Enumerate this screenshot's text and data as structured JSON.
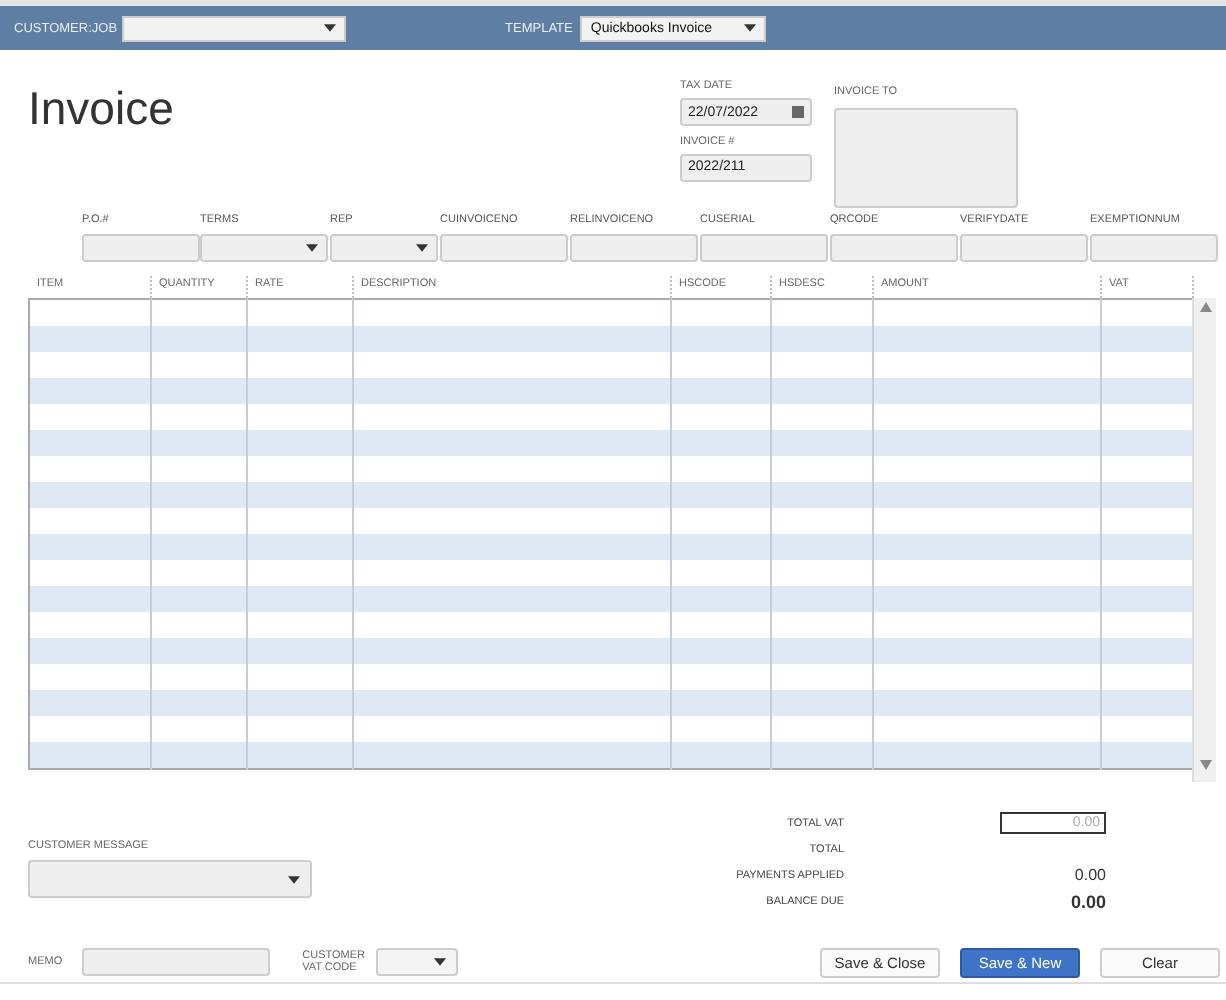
{
  "header": {
    "customer_job": {
      "label": "CUSTOMER:JOB"
    },
    "template": {
      "label": "TEMPLATE",
      "value": "Quickbooks Invoice"
    }
  },
  "title": "Invoice",
  "tax_date": {
    "label": "TAX DATE",
    "value": "22/07/2022"
  },
  "invoice_number": {
    "label": "INVOICE #",
    "value": "2022/211"
  },
  "invoice_to": {
    "label": "INVOICE TO"
  },
  "fields": [
    {
      "label": "P.O.#",
      "kind": "text"
    },
    {
      "label": "TERMS",
      "kind": "dropdown"
    },
    {
      "label": "REP",
      "kind": "dropdown"
    },
    {
      "label": "CUINVOICENO",
      "kind": "text"
    },
    {
      "label": "RELINVOICENO",
      "kind": "text"
    },
    {
      "label": "CUSERIAL",
      "kind": "text"
    },
    {
      "label": "QRCODE",
      "kind": "text"
    },
    {
      "label": "VERIFYDATE",
      "kind": "text"
    },
    {
      "label": "EXEMPTIONNUM",
      "kind": "text"
    }
  ],
  "table": {
    "columns": [
      "ITEM",
      "QUANTITY",
      "RATE",
      "DESCRIPTION",
      "HSCODE",
      "HSDESC",
      "AMOUNT",
      "VAT"
    ]
  },
  "totals": [
    {
      "label": "TOTAL VAT",
      "placeholder": "0.00",
      "kind": "field"
    },
    {
      "label": "TOTAL",
      "kind": "label"
    },
    {
      "label": "PAYMENTS APPLIED",
      "value": "0.00",
      "kind": "plain"
    },
    {
      "label": "BALANCE DUE",
      "value": "0.00",
      "kind": "bold"
    }
  ],
  "customer_message": {
    "label": "CUSTOMER MESSAGE"
  },
  "memo": {
    "label": "MEMO"
  },
  "customer_vat_code": {
    "label": "CUSTOMER VAT CODE"
  },
  "buttons": [
    {
      "label": "Save & Close",
      "kind": "secondary"
    },
    {
      "label": "Save & New",
      "kind": "primary"
    },
    {
      "label": "Clear",
      "kind": "secondary"
    }
  ]
}
